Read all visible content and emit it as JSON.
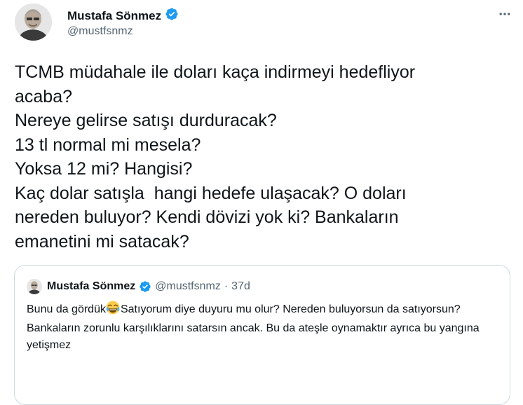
{
  "author": {
    "name": "Mustafa Sönmez",
    "handle": "@mustfsnmz",
    "verified": true
  },
  "tweet": {
    "text": "TCMB müdahale ile doları kaça indirmeyi hedefliyor\nacaba?\nNereye gelirse satışı durduracak?\n13 tl normal mi mesela?\nYoksa 12 mi? Hangisi?\nKaç dolar satışla  hangi hedefe ulaşacak? O doları\nnereden buluyor? Kendi dövizi yok ki? Bankaların\nemanetini mi satacak?"
  },
  "quoted": {
    "name": "Mustafa Sönmez",
    "handle": "@mustfsnmz",
    "separator": "·",
    "time": "37d",
    "text_before_emoji": "Bunu da gördük",
    "emoji_icon": "face-with-tears-of-joy-icon",
    "text_after_emoji": "Satıyorum diye duyuru mu olur? Nereden buluyorsun da satıyorsun? Bankaların zorunlu karşılıklarını satarsın ancak. Bu da ateşle oynamaktır ayrıca bu yangına yetişmez"
  },
  "colors": {
    "text": "#0f1419",
    "secondary": "#536471",
    "verified": "#1d9bf0",
    "border": "#cfd9de"
  }
}
